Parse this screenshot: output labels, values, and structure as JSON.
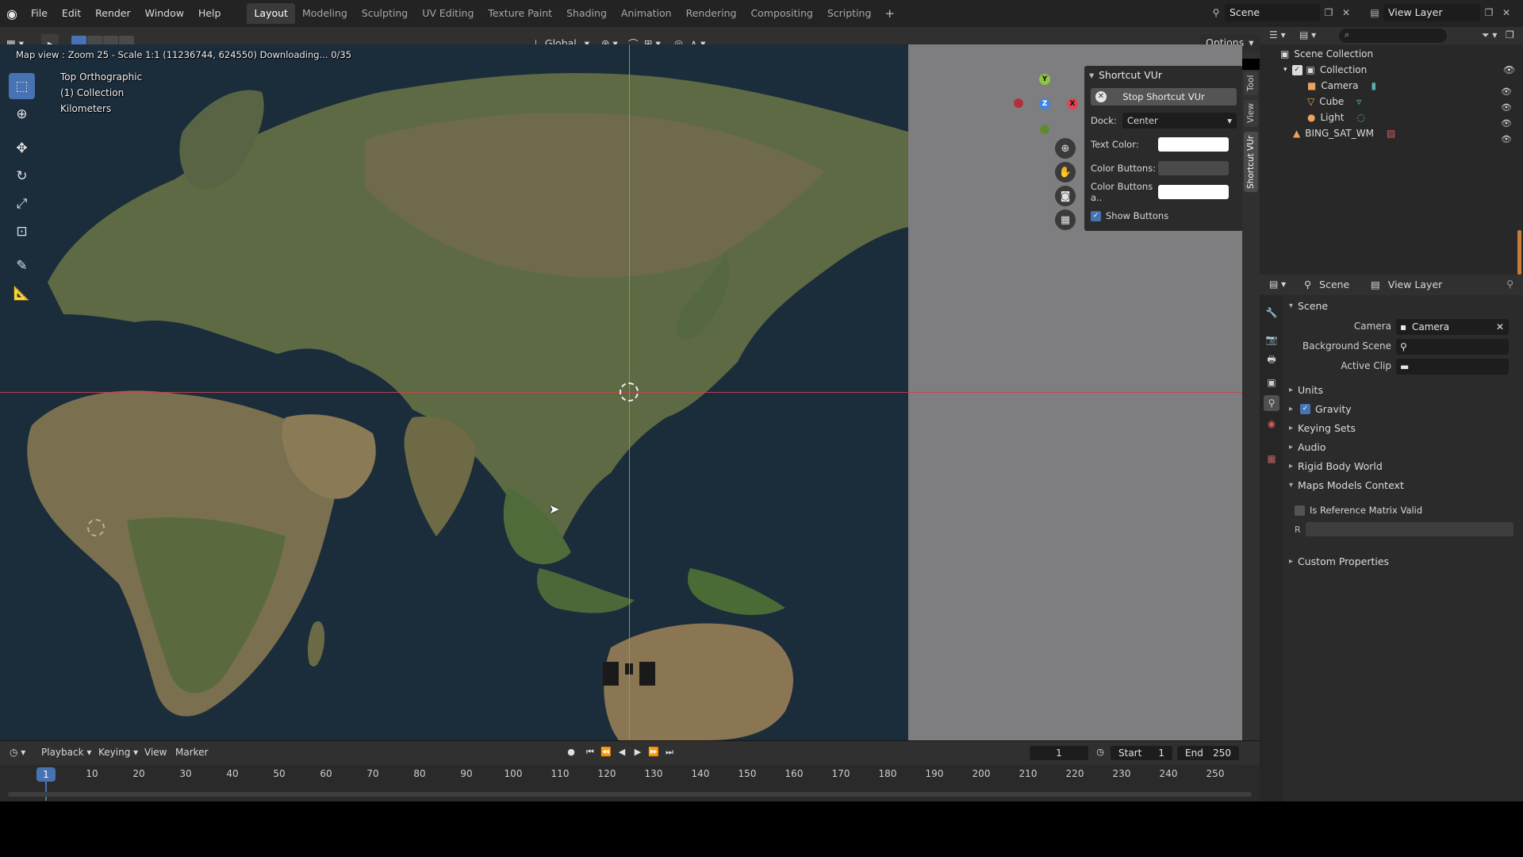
{
  "menu": [
    "File",
    "Edit",
    "Render",
    "Window",
    "Help"
  ],
  "workspaces": [
    "Layout",
    "Modeling",
    "Sculpting",
    "UV Editing",
    "Texture Paint",
    "Shading",
    "Animation",
    "Rendering",
    "Compositing",
    "Scripting"
  ],
  "active_workspace": "Layout",
  "scene_name": "Scene",
  "view_layer_name": "View Layer",
  "viewport_header": {
    "orientation": "Global",
    "options_label": "Options"
  },
  "viewport": {
    "map_status": "Map view : Zoom 25 - Scale 1:1 (11236744, 624550) Downloading... 0/35",
    "view_name": "Top Orthographic",
    "collection": "(1) Collection",
    "units": "Kilometers"
  },
  "gizmo": {
    "x": "X",
    "y": "Y",
    "z": "Z"
  },
  "shortcut_panel": {
    "title": "Shortcut VUr",
    "stop_button": "Stop Shortcut VUr",
    "dock_label": "Dock:",
    "dock_value": "Center",
    "text_color_label": "Text Color:",
    "text_color": "#ffffff",
    "color_buttons_label": "Color Buttons:",
    "color_buttons": "#4a4a4a",
    "color_buttons_a_label": "Color Buttons a..",
    "color_buttons_a": "#ffffff",
    "show_buttons_label": "Show Buttons",
    "show_buttons": true
  },
  "side_tabs": [
    "Tool",
    "View",
    "Shortcut VUr"
  ],
  "timeline": {
    "menus": [
      "Playback",
      "Keying",
      "View",
      "Marker"
    ],
    "current_frame": "1",
    "start_label": "Start",
    "start": "1",
    "end_label": "End",
    "end": "250",
    "ruler_ticks": [
      "10",
      "20",
      "30",
      "40",
      "50",
      "60",
      "70",
      "80",
      "90",
      "100",
      "110",
      "120",
      "130",
      "140",
      "150",
      "160",
      "170",
      "180",
      "190",
      "200",
      "210",
      "220",
      "230",
      "240",
      "250"
    ],
    "marker_label": "1"
  },
  "outliner": {
    "scene_collection": "Scene Collection",
    "collection": "Collection",
    "camera": "Camera",
    "cube": "Cube",
    "light": "Light",
    "bing": "BING_SAT_WM"
  },
  "properties": {
    "header_scene": "Scene",
    "header_view_layer": "View Layer",
    "section_scene": "Scene",
    "camera_label": "Camera",
    "camera_value": "Camera",
    "background_scene_label": "Background Scene",
    "active_clip_label": "Active Clip",
    "units": "Units",
    "gravity": "Gravity",
    "keying_sets": "Keying Sets",
    "audio": "Audio",
    "rigid_body_world": "Rigid Body World",
    "maps_models_context": "Maps Models Context",
    "is_reference_matrix_valid": "Is Reference Matrix Valid",
    "r_label": "R",
    "custom_properties": "Custom Properties"
  }
}
